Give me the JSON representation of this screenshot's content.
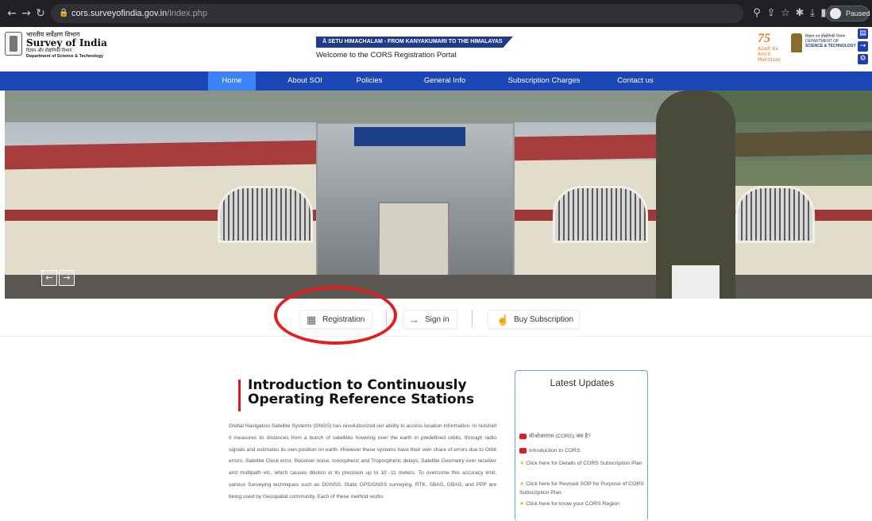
{
  "browser": {
    "url_host": "cors.surveyofindia.gov.in",
    "url_path": "/index.php",
    "profile_status": "Paused"
  },
  "header": {
    "org_hindi": "भारतीय सर्वेक्षण विभाग",
    "org_name": "Survey of India",
    "org_sub_hindi": "विज्ञान और प्रौद्योगिकी विभाग",
    "org_sub": "Department of Science & Technology",
    "banner": "Ā SETU HIMACHALAM - FROM KANYAKUMARI TO THE HIMALAYAS",
    "welcome": "Welcome to the CORS Registration Portal",
    "azadi_num": "75",
    "azadi_text": "Azadi Ka Amrit Mahotsav",
    "dst_hindi": "विज्ञान एवं प्रौद्योगिकी विभाग",
    "dst_line1": "DEPARTMENT OF",
    "dst_line2": "SCIENCE & TECHNOLOGY"
  },
  "nav": {
    "items": [
      "Home",
      "About SOI",
      "Policies",
      "General Info",
      "Subscription Charges",
      "Contact us"
    ]
  },
  "actions": {
    "registration": "Registration",
    "signin": "Sign in",
    "buy": "Buy Subscription"
  },
  "intro": {
    "title_line1": "Introduction to Continuously",
    "title_line2": "Operating Reference Stations",
    "body": "Global Navigation Satellite Systems (GNSS) has revolutionized our ability to access location information. In nutshell it measures its distances from a bunch of satellites hovering over the earth in predefined orbits, through radio signals and estimates its own position on earth. However these systems have their own share of errors due to Orbit errors, Satellite Clock error, Receiver noise, Ionospheric and Tropospheric delays, Satellite Geometry over receiver and multipath etc, which causes dilution in its precision up to 10 -11 meters. To overcome this accuracy limit, various Surveying techniques such as DGNSS, Static GPS/GNSS surveying, RTK, SBAS, GBAS, and PPP are being used by Geospatial community. Each of these method works"
  },
  "updates": {
    "title": "Latest Updates",
    "items": [
      "सीओआरएस (CORS) क्या है?",
      "Introduction to CORS",
      "Click here for Details of CORS Subscription Plan",
      "Click here for Revised SOP for Purpose of CORS Subscription Plan",
      "Click here for know your CORS Region"
    ]
  },
  "colors": {
    "nav_bg": "#1a46b8",
    "nav_active": "#3b82f6",
    "accent_red": "#d91c1c",
    "annotation_circle": "#e11d1d"
  }
}
